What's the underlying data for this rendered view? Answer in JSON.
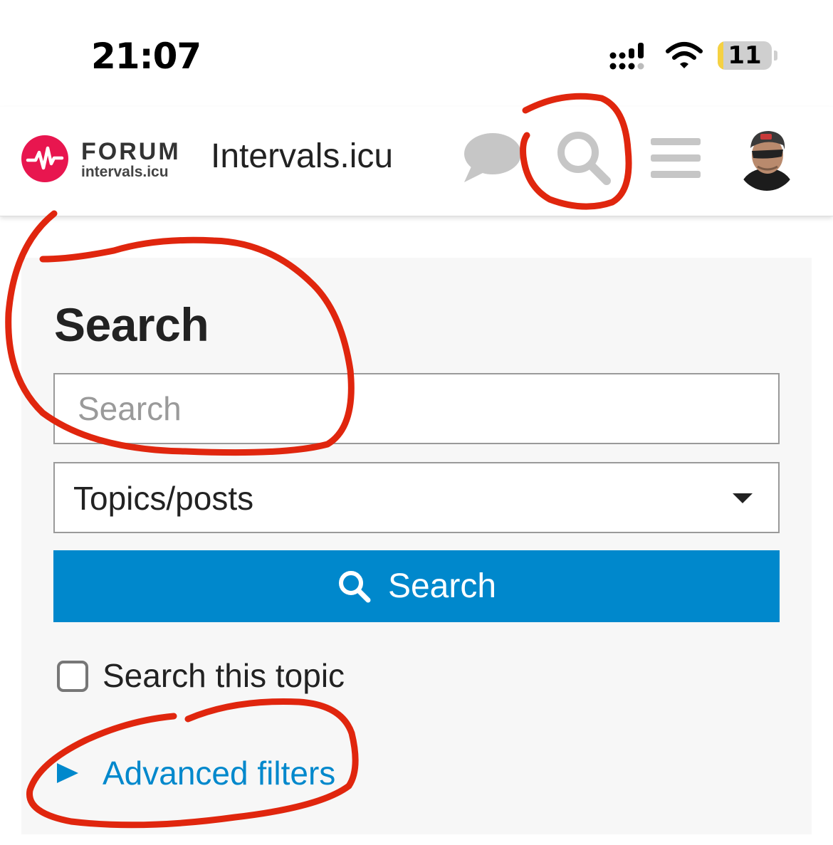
{
  "status_bar": {
    "time": "21:07",
    "battery_level": "11",
    "battery_fraction": 0.11
  },
  "header": {
    "logo_title": "FORUM",
    "logo_subtitle": "intervals.icu",
    "site_title": "Intervals.icu",
    "icons": [
      "chat-icon",
      "search-icon",
      "hamburger-menu-icon",
      "user-avatar"
    ]
  },
  "search_panel": {
    "title": "Search",
    "input_placeholder": "Search",
    "input_value": "",
    "scope_selected": "Topics/posts",
    "search_button_label": "Search",
    "search_this_topic_label": "Search this topic",
    "search_this_topic_checked": false,
    "advanced_filters_label": "Advanced filters"
  },
  "colors": {
    "brand_red": "#e8164f",
    "accent_blue": "#0088cc",
    "panel_bg": "#f7f7f7",
    "annotation_red": "#e0260e"
  }
}
